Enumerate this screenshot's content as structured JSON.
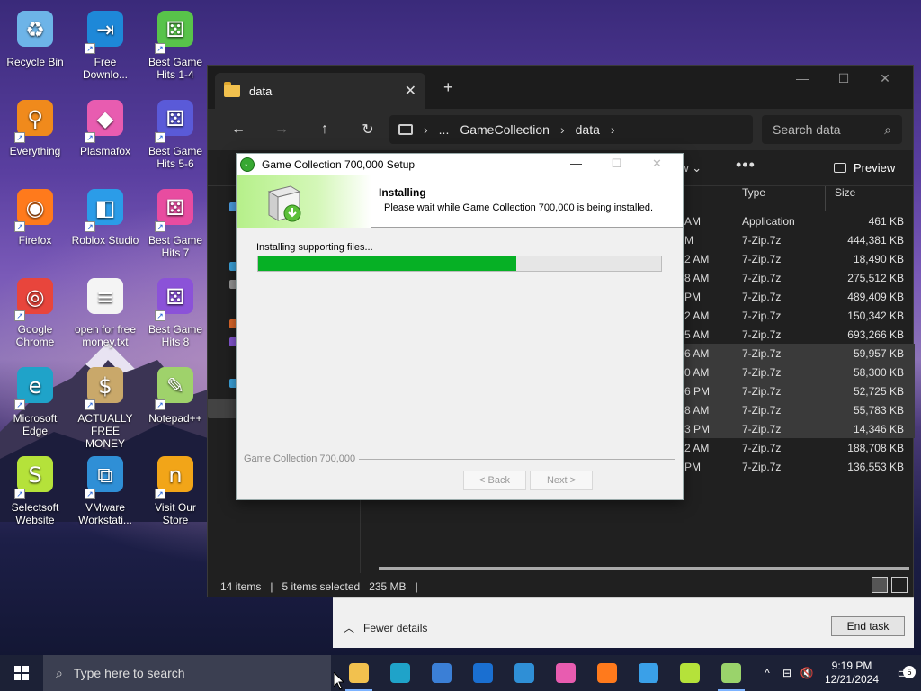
{
  "desktop": {
    "icons": [
      {
        "label": "Recycle Bin",
        "icon": "recycle-bin-icon"
      },
      {
        "label": "Free Downlo...",
        "icon": "download-app-icon"
      },
      {
        "label": "Best Game Hits 1-4",
        "icon": "dice-green-icon"
      },
      {
        "label": "Everything",
        "icon": "magnifier-icon"
      },
      {
        "label": "Plasmafox",
        "icon": "plasmafox-icon"
      },
      {
        "label": "Best Game Hits 5-6",
        "icon": "dice-blue-icon"
      },
      {
        "label": "Firefox",
        "icon": "firefox-icon"
      },
      {
        "label": "Roblox Studio",
        "icon": "roblox-studio-icon"
      },
      {
        "label": "Best Game Hits 7",
        "icon": "dice-pink-icon"
      },
      {
        "label": "Google Chrome",
        "icon": "chrome-icon"
      },
      {
        "label": "open for free money.txt",
        "icon": "text-file-icon"
      },
      {
        "label": "Best Game Hits 8",
        "icon": "dice-purple-icon"
      },
      {
        "label": "Microsoft Edge",
        "icon": "edge-icon"
      },
      {
        "label": "ACTUALLY FREE MONEY",
        "icon": "money-bag-icon"
      },
      {
        "label": "Notepad++",
        "icon": "notepad-plus-icon"
      },
      {
        "label": "Selectsoft Website",
        "icon": "selectsoft-icon"
      },
      {
        "label": "VMware Workstati...",
        "icon": "vmware-icon"
      },
      {
        "label": "Visit Our Store",
        "icon": "store-icon"
      }
    ]
  },
  "explorer": {
    "tab_label": "data",
    "new_tab": "+",
    "breadcrumb": {
      "more": "...",
      "items": [
        "GameCollection",
        "data"
      ]
    },
    "search_placeholder": "Search data",
    "view_label": "ew",
    "more_label": "•••",
    "preview_label": "Preview",
    "columns": {
      "type": "Type",
      "size": "Size"
    },
    "rows": [
      {
        "time": "AM",
        "type": "Application",
        "size": "461 KB",
        "selected": false
      },
      {
        "time": "M",
        "type": "7-Zip.7z",
        "size": "444,381 KB",
        "selected": false
      },
      {
        "time": "2 AM",
        "type": "7-Zip.7z",
        "size": "18,490 KB",
        "selected": false
      },
      {
        "time": "8 AM",
        "type": "7-Zip.7z",
        "size": "275,512 KB",
        "selected": false
      },
      {
        "time": "PM",
        "type": "7-Zip.7z",
        "size": "489,409 KB",
        "selected": false
      },
      {
        "time": "2 AM",
        "type": "7-Zip.7z",
        "size": "150,342 KB",
        "selected": false
      },
      {
        "time": "5 AM",
        "type": "7-Zip.7z",
        "size": "693,266 KB",
        "selected": false
      },
      {
        "time": "6 AM",
        "type": "7-Zip.7z",
        "size": "59,957 KB",
        "selected": true
      },
      {
        "time": "0 AM",
        "type": "7-Zip.7z",
        "size": "58,300 KB",
        "selected": true
      },
      {
        "time": "6 PM",
        "type": "7-Zip.7z",
        "size": "52,725 KB",
        "selected": true
      },
      {
        "time": "8 AM",
        "type": "7-Zip.7z",
        "size": "55,783 KB",
        "selected": true
      },
      {
        "time": "3 PM",
        "type": "7-Zip.7z",
        "size": "14,346 KB",
        "selected": true
      },
      {
        "time": "2 AM",
        "type": "7-Zip.7z",
        "size": "188,708 KB",
        "selected": false
      },
      {
        "time": "PM",
        "type": "7-Zip.7z",
        "size": "136,553 KB",
        "selected": false
      }
    ],
    "status": {
      "items": "14 items",
      "selected": "5 items selected",
      "size": "235 MB"
    }
  },
  "taskmgr": {
    "fewer_details": "Fewer details",
    "end_task": "End task"
  },
  "setup": {
    "title": "Game Collection 700,000 Setup",
    "heading": "Installing",
    "subheading": "Please wait while Game Collection 700,000 is being installed.",
    "status": "Installing supporting files...",
    "progress_fraction": 0.64,
    "brand": "Game Collection 700,000",
    "back_label": "< Back",
    "next_label": "Next >"
  },
  "taskbar": {
    "search_placeholder": "Type here to search",
    "apps": [
      "file-explorer-icon",
      "edge-icon",
      "store-icon",
      "outlook-icon",
      "vmware-icon",
      "plasmafox-icon",
      "firefox-icon",
      "photos-icon",
      "selectsoft-icon",
      "setup-icon"
    ],
    "clock_time": "9:19 PM",
    "clock_date": "12/21/2024",
    "notifications_count": "5"
  }
}
